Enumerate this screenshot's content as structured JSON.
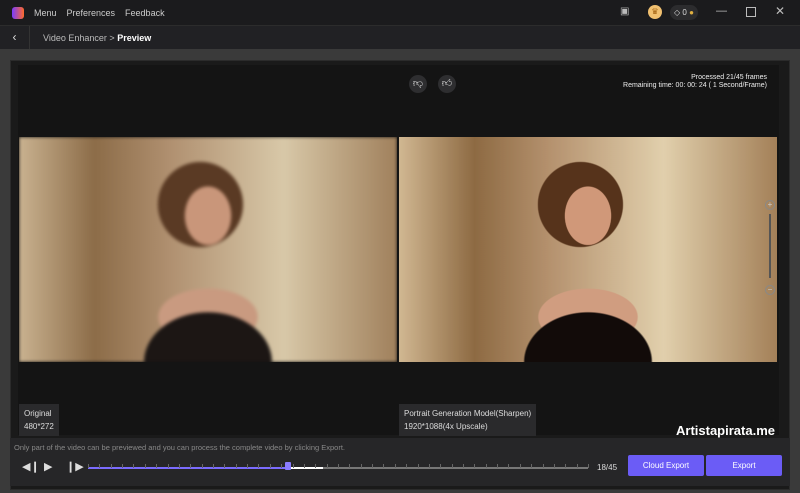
{
  "titlebar": {
    "menu": "Menu",
    "preferences": "Preferences",
    "feedback": "Feedback",
    "gem_count": "0"
  },
  "breadcrumb": {
    "parent": "Video Enhancer",
    "separator": ">",
    "current": "Preview"
  },
  "status": {
    "processed": "Processed 21/45 frames",
    "remaining": "Remaining time: 00: 00: 24 ( 1 Second/Frame)"
  },
  "original": {
    "title": "Original",
    "resolution": "480*272"
  },
  "enhanced": {
    "title": "Portrait Generation Model(Sharpen)",
    "resolution": "1920*1088(4x Upscale)"
  },
  "zoom": {
    "plus": "+",
    "minus": "−",
    "level": 0.15
  },
  "bottom": {
    "note": "Only part of the video can be previewed and you can process the complete video by clicking Export.",
    "frame_counter": "18/45",
    "progress": 0.4,
    "buffered": 0.47,
    "cloud_export": "Cloud Export",
    "export": "Export"
  },
  "watermark": "Artistapirata.me",
  "colors": {
    "accent": "#6b5cf6"
  }
}
